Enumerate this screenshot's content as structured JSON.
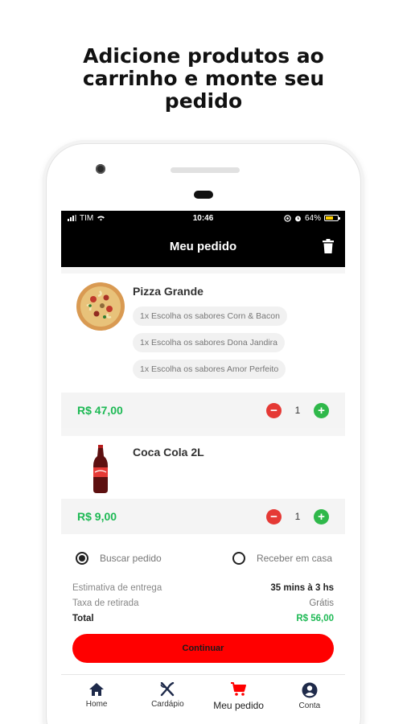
{
  "headline": {
    "line1": "Adicione produtos ao",
    "line2": "carrinho e monte seu",
    "line3": "pedido"
  },
  "status_bar": {
    "carrier": "TIM",
    "time": "10:46",
    "battery": "64%"
  },
  "app_bar": {
    "title": "Meu pedido",
    "trash_icon": "trash-icon"
  },
  "items": [
    {
      "name": "Pizza Grande",
      "options": [
        "1x Escolha os sabores Corn & Bacon",
        "1x Escolha os sabores Dona Jandira",
        "1x Escolha os sabores Amor Perfeito"
      ],
      "price": "R$ 47,00",
      "quantity": "1"
    },
    {
      "name": "Coca Cola 2L",
      "options": [],
      "price": "R$ 9,00",
      "quantity": "1"
    }
  ],
  "delivery_options": {
    "pickup": "Buscar pedido",
    "delivery": "Receber em casa",
    "selected": "pickup"
  },
  "summary": {
    "estimate_label": "Estimativa de entrega",
    "estimate_value": "35 mins à 3 hs",
    "fee_label": "Taxa de retirada",
    "fee_value": "Grátis",
    "total_label": "Total",
    "total_value": "R$ 56,00"
  },
  "cta": {
    "label": "Continuar"
  },
  "tabs": [
    {
      "label": "Home",
      "icon": "home-icon"
    },
    {
      "label": "Cardápio",
      "icon": "utensils-icon"
    },
    {
      "label": "Meu pedido",
      "icon": "cart-icon"
    },
    {
      "label": "Conta",
      "icon": "account-icon"
    }
  ],
  "colors": {
    "accent_red": "#ff0000",
    "price_green": "#1db954",
    "header_black": "#000000"
  }
}
